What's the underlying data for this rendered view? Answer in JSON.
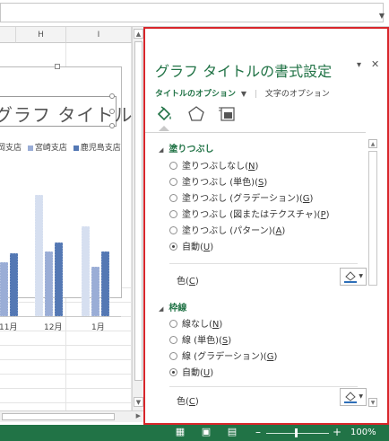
{
  "sheet": {
    "columns": [
      "H",
      "I"
    ]
  },
  "chart": {
    "title": "グラフ タイトル",
    "legend": [
      "岡支店",
      "宮崎支店",
      "鹿児島支店"
    ],
    "colors": {
      "series1": "#d6dff0",
      "series2": "#9aadd6",
      "series3": "#5478b4"
    }
  },
  "chart_data": {
    "type": "bar",
    "title": "グラフ タイトル",
    "categories": [
      "11月",
      "12月",
      "1月"
    ],
    "series": [
      {
        "name": "岡支店",
        "values": [
          null,
          135,
          100
        ]
      },
      {
        "name": "宮崎支店",
        "values": [
          60,
          72,
          55
        ]
      },
      {
        "name": "鹿児島支店",
        "values": [
          70,
          82,
          72
        ]
      }
    ],
    "xlabel": "",
    "ylabel": "",
    "grid": false,
    "legend_position": "top"
  },
  "pane": {
    "title": "グラフ タイトルの書式設定",
    "tab_title_options": "タイトルのオプション",
    "tab_text_options": "文字のオプション",
    "icons": [
      "fill-line-icon",
      "effects-pentagon-icon",
      "size-properties-icon"
    ],
    "fill": {
      "header": "塗りつぶし",
      "options": [
        {
          "text": "塗りつぶしなし(",
          "key": "N",
          "checked": false
        },
        {
          "text": "塗りつぶし (単色)(",
          "key": "S",
          "checked": false
        },
        {
          "text": "塗りつぶし (グラデーション)(",
          "key": "G",
          "checked": false
        },
        {
          "text": "塗りつぶし (図またはテクスチャ)(",
          "key": "P",
          "checked": false
        },
        {
          "text": "塗りつぶし (パターン)(",
          "key": "A",
          "checked": false
        },
        {
          "text": "自動(",
          "key": "U",
          "checked": true
        }
      ],
      "color_label": "色(",
      "color_key": "C"
    },
    "border": {
      "header": "枠線",
      "options": [
        {
          "text": "線なし(",
          "key": "N",
          "checked": false
        },
        {
          "text": "線 (単色)(",
          "key": "S",
          "checked": false
        },
        {
          "text": "線 (グラデーション)(",
          "key": "G",
          "checked": false
        },
        {
          "text": "自動(",
          "key": "U",
          "checked": true
        }
      ],
      "color_label": "色(",
      "color_key": "C"
    }
  },
  "status": {
    "zoom": "100%"
  },
  "accent": "#217346",
  "highlight": "#d8262b"
}
